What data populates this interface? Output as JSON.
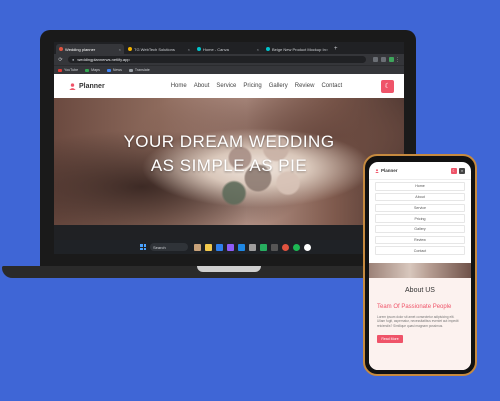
{
  "browser": {
    "tabs": [
      {
        "label": "Wedding planner",
        "active": true
      },
      {
        "label": "TG WebTech Solutions",
        "active": false
      },
      {
        "label": "Home - Canva",
        "active": false
      },
      {
        "label": "Beige New Product Mockup In",
        "active": false
      }
    ],
    "new_tab": "+",
    "url": "weddingplannerws.netlify.app",
    "bookmarks": [
      {
        "label": "YouTube",
        "icon": "youtube-icon"
      },
      {
        "label": "Maps",
        "icon": "maps-icon"
      },
      {
        "label": "News",
        "icon": "news-icon"
      },
      {
        "label": "Translate",
        "icon": "translate-icon"
      }
    ]
  },
  "site": {
    "logo_text": "Planner",
    "nav": [
      "Home",
      "About",
      "Service",
      "Pricing",
      "Gallery",
      "Review",
      "Contact"
    ],
    "hero_line1": "YOUR DREAM WEDDING",
    "hero_line2": "AS SIMPLE AS PIE",
    "accent_color": "#ef5469"
  },
  "taskbar": {
    "search_label": "Search",
    "tray_line1": "ENG",
    "tray_line2": "IN"
  },
  "mobile": {
    "logo_text": "Planner",
    "nav": [
      "Home",
      "About",
      "Service",
      "Pricing",
      "Gallery",
      "Review",
      "Contact"
    ],
    "about_title": "About US",
    "team_title": "Team Of Passionate People",
    "paragraph": "Lorem ipsum dolor sit amet consectetur adipisicing elit. Ullam fugit, aspernatur, necessitatibus eveniet aut impedit reiciendis? Similique quasi magnam possimus.",
    "button_label": "Read More"
  }
}
